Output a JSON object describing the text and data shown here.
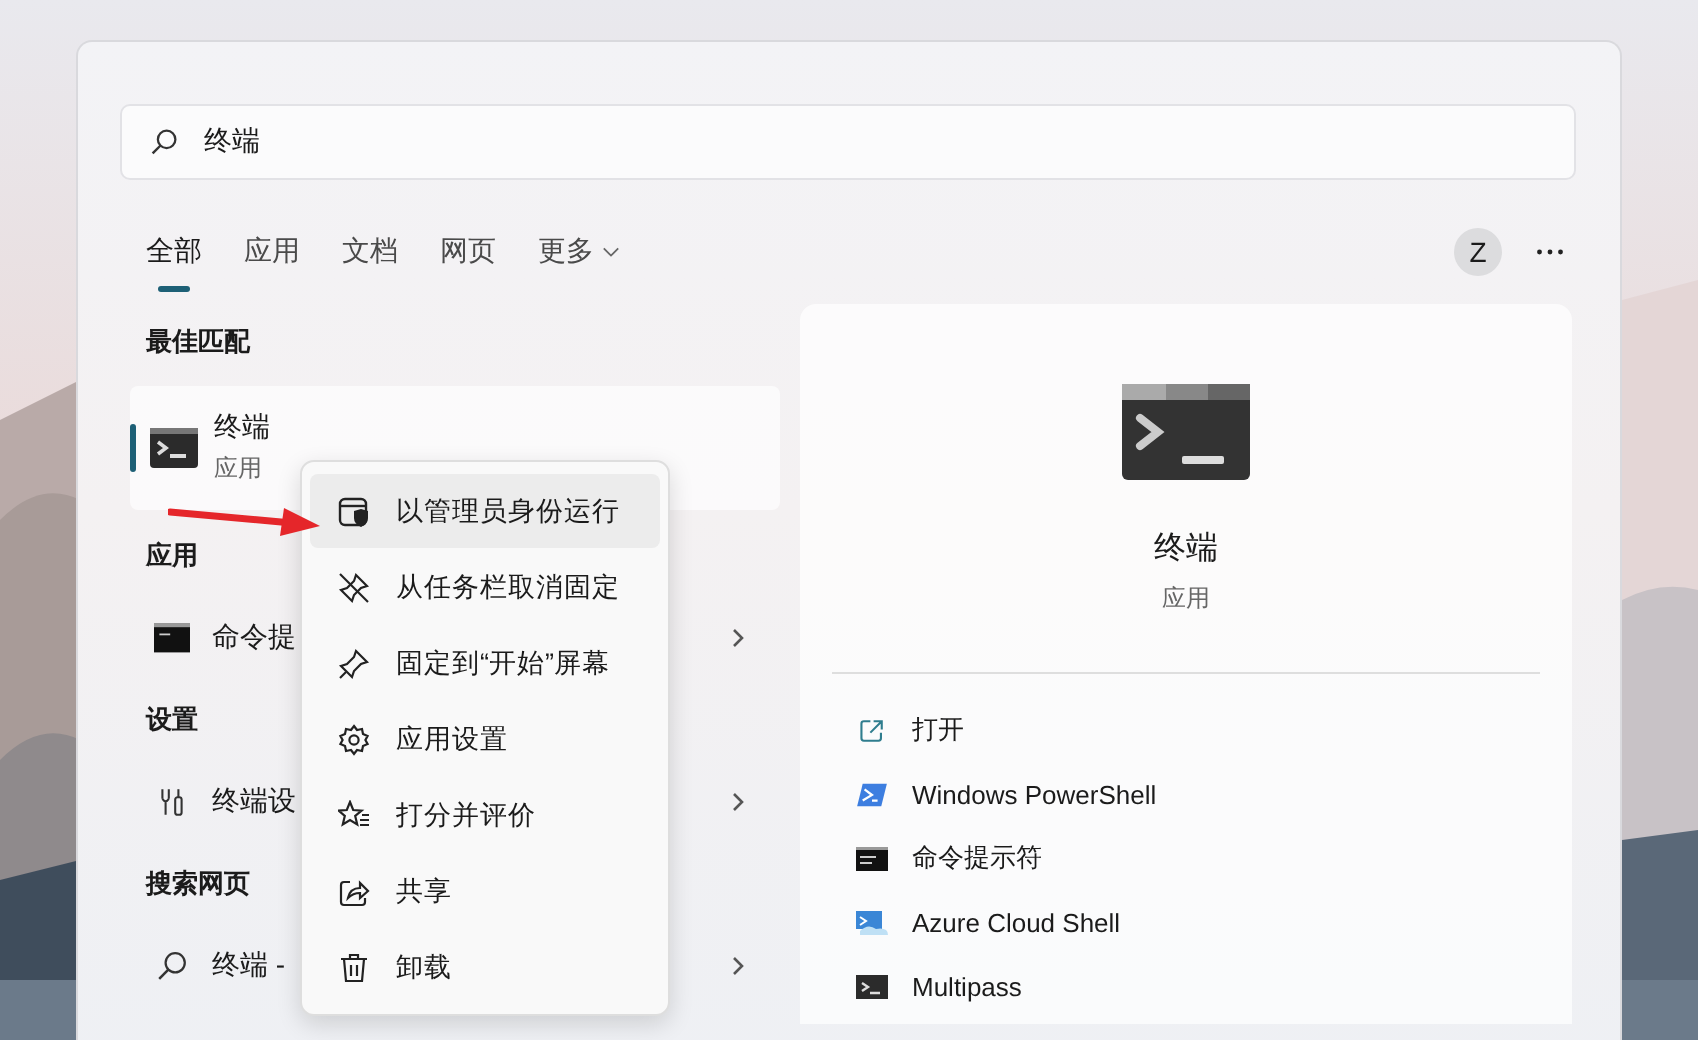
{
  "search": {
    "value": "终端"
  },
  "tabs": [
    {
      "label": "全部",
      "selected": true,
      "kind": "tab"
    },
    {
      "label": "应用",
      "selected": false,
      "kind": "tab"
    },
    {
      "label": "文档",
      "selected": false,
      "kind": "tab"
    },
    {
      "label": "网页",
      "selected": false,
      "kind": "tab"
    },
    {
      "label": "更多",
      "selected": false,
      "kind": "dropdown"
    }
  ],
  "account": {
    "initial": "Z"
  },
  "sections": [
    {
      "heading": "最佳匹配",
      "items": [
        {
          "kind": "best",
          "title": "终端",
          "subtitle": "应用",
          "selected": true
        }
      ]
    },
    {
      "heading": "应用",
      "items": [
        {
          "kind": "app",
          "title": "命令提",
          "selected": false
        }
      ]
    },
    {
      "heading": "设置",
      "items": [
        {
          "kind": "setting",
          "title": "终端设",
          "selected": false
        }
      ]
    },
    {
      "heading": "搜索网页",
      "items": [
        {
          "kind": "web",
          "title": "终端 -",
          "selected": false
        }
      ]
    }
  ],
  "detail": {
    "title": "终端",
    "subtitle": "应用",
    "actions": [
      {
        "kind": "open",
        "label": "打开"
      },
      {
        "kind": "powershell",
        "label": "Windows PowerShell"
      },
      {
        "kind": "cmd",
        "label": "命令提示符"
      },
      {
        "kind": "azure",
        "label": "Azure Cloud Shell"
      },
      {
        "kind": "multipass",
        "label": "Multipass"
      }
    ]
  },
  "context_menu": [
    {
      "kind": "admin",
      "label": "以管理员身份运行",
      "selected": true
    },
    {
      "kind": "unpin",
      "label": "从任务栏取消固定",
      "selected": false
    },
    {
      "kind": "pin",
      "label": "固定到“开始”屏幕",
      "selected": false
    },
    {
      "kind": "settings",
      "label": "应用设置",
      "selected": false
    },
    {
      "kind": "rate",
      "label": "打分并评价",
      "selected": false
    },
    {
      "kind": "share",
      "label": "共享",
      "selected": false
    },
    {
      "kind": "uninstall",
      "label": "卸载",
      "selected": false
    }
  ]
}
